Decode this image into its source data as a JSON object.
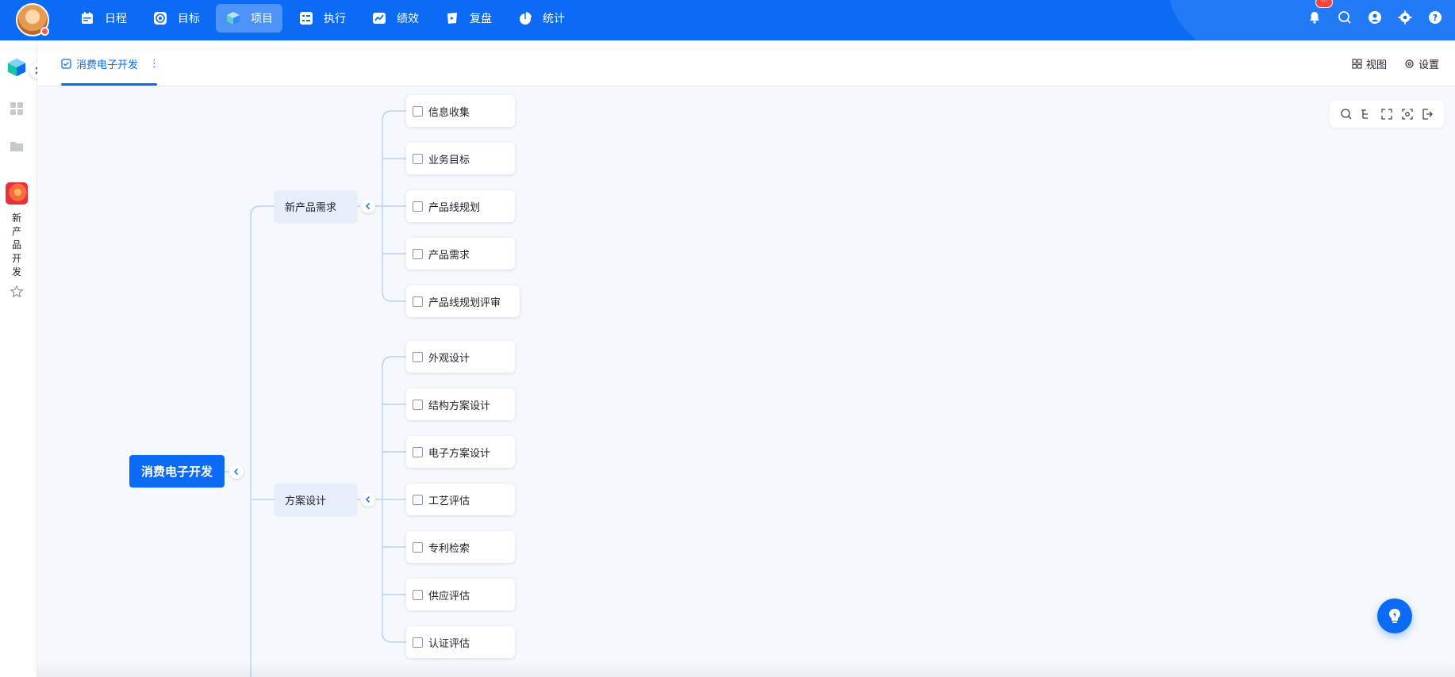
{
  "nav": {
    "items": [
      {
        "label": "日程",
        "icon": "calendar-icon",
        "active": false
      },
      {
        "label": "目标",
        "icon": "target-icon",
        "active": false
      },
      {
        "label": "项目",
        "icon": "cube-icon",
        "active": true
      },
      {
        "label": "执行",
        "icon": "checklist-icon",
        "active": false
      },
      {
        "label": "绩效",
        "icon": "performance-icon",
        "active": false
      },
      {
        "label": "复盘",
        "icon": "review-icon",
        "active": false
      },
      {
        "label": "统计",
        "icon": "pie-chart-icon",
        "active": false
      }
    ],
    "right_icons": [
      "bell-icon",
      "search-icon",
      "user-circle-icon",
      "gear-icon",
      "help-icon"
    ],
    "notification_badge": "···"
  },
  "sidebar": {
    "project_label": "新产品开发"
  },
  "tab": {
    "title": "消费电子开发",
    "more": "⋮"
  },
  "tab_actions": {
    "view": "视图",
    "settings": "设置"
  },
  "mindmap": {
    "root": "消费电子开发",
    "branches": [
      {
        "label": "新产品需求",
        "leaves": [
          "信息收集",
          "业务目标",
          "产品线规划",
          "产品需求",
          "产品线规划评审"
        ]
      },
      {
        "label": "方案设计",
        "leaves": [
          "外观设计",
          "结构方案设计",
          "电子方案设计",
          "工艺评估",
          "专利检索",
          "供应评估",
          "认证评估"
        ]
      }
    ]
  },
  "colors": {
    "brand": "#0b6bf5",
    "branch_bg": "#e6eefc",
    "canvas_bg": "#f5f8fd",
    "connector": "#b9d0f5"
  }
}
